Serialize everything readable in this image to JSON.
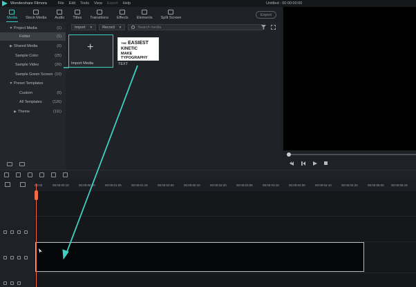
{
  "app": {
    "name": "Wondershare Filmora",
    "window_title": "Untitled : 00:00:00:00",
    "menu": [
      "File",
      "Edit",
      "Tools",
      "View",
      "Export",
      "Help"
    ]
  },
  "tabs": [
    {
      "label": "Media",
      "icon": "folder-icon",
      "active": true
    },
    {
      "label": "Stock Media",
      "icon": "stock-media-icon",
      "active": false
    },
    {
      "label": "Audio",
      "icon": "music-note-icon",
      "active": false
    },
    {
      "label": "Titles",
      "icon": "text-t-icon",
      "active": false
    },
    {
      "label": "Transitions",
      "icon": "transition-icon",
      "active": false
    },
    {
      "label": "Effects",
      "icon": "effects-icon",
      "active": false
    },
    {
      "label": "Elements",
      "icon": "elements-icon",
      "active": false
    },
    {
      "label": "Split Screen",
      "icon": "split-screen-icon",
      "active": false
    }
  ],
  "export_label": "Export",
  "sidebar": {
    "items": [
      {
        "label": "Project Media",
        "count": "(1)"
      },
      {
        "label": "Folder",
        "count": "(1)",
        "selected": true
      },
      {
        "label": "Shared Media",
        "count": "(0)"
      },
      {
        "label": "Sample Color",
        "count": "(25)"
      },
      {
        "label": "Sample Video",
        "count": "(26)"
      },
      {
        "label": "Sample Green Screen",
        "count": "(10)"
      },
      {
        "label": "Preset Templates",
        "count": ""
      },
      {
        "label": "Custom",
        "count": "(0)"
      },
      {
        "label": "All Templates",
        "count": "(126)"
      },
      {
        "label": "Theme",
        "count": "(111)"
      }
    ]
  },
  "media": {
    "import_label": "Import",
    "record_label": "Record",
    "search_placeholder": "Search media",
    "import_tile_label": "Import Media",
    "text_tile_label": "TEXT",
    "thumb": {
      "line1": "THE",
      "line2": "EASIEST",
      "line3": "KINETIC",
      "line4": "MAKE TYPOGRAPHY"
    }
  },
  "timeline": {
    "ticks": [
      "00:00",
      "00:00:00:10",
      "00:00:00:20",
      "00:00:01:05",
      "00:00:01:15",
      "00:00:02:00",
      "00:00:02:10",
      "00:00:02:20",
      "00:00:03:05",
      "00:00:03:15",
      "00:00:04:00",
      "00:00:04:10",
      "00:00:04:20",
      "00:00:05:05",
      "00:00:05:15"
    ]
  },
  "colors": {
    "accent": "#3fd0c4",
    "playhead": "#f06b4a",
    "background": "#1b1e23"
  }
}
